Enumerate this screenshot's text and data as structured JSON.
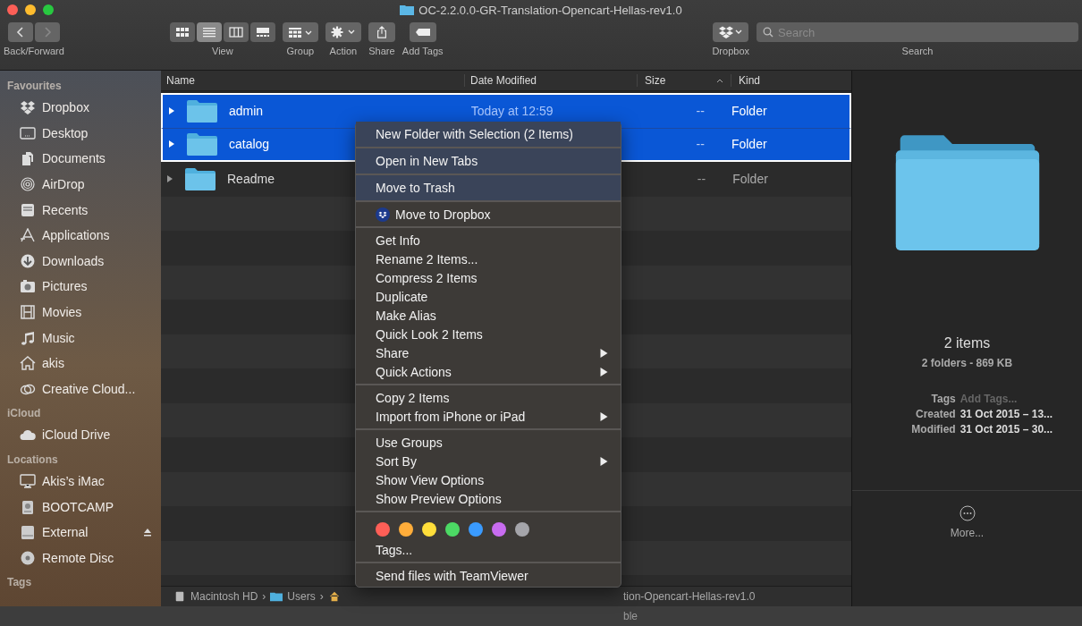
{
  "window": {
    "title": "OC-2.2.0.0-GR-Translation-Opencart-Hellas-rev1.0"
  },
  "toolbar": {
    "back_forward_label": "Back/Forward",
    "view": {
      "label": "View",
      "modes": [
        {
          "selected": false
        },
        {
          "selected": true
        },
        {
          "selected": false
        },
        {
          "selected": false
        }
      ]
    },
    "tools": [
      {
        "kind": "group",
        "label": "Group"
      },
      {
        "kind": "action",
        "label": "Action"
      },
      {
        "kind": "share",
        "label": "Share"
      },
      {
        "kind": "tags",
        "label": "Add Tags"
      }
    ],
    "dropbox_label": "Dropbox",
    "search": {
      "placeholder": "Search",
      "label": "Search"
    }
  },
  "sidebar": {
    "sections": [
      {
        "title": "Favourites",
        "items": [
          {
            "label": "Dropbox"
          },
          {
            "label": "Desktop"
          },
          {
            "label": "Documents"
          },
          {
            "label": "AirDrop"
          },
          {
            "label": "Recents"
          },
          {
            "label": "Applications"
          },
          {
            "label": "Downloads"
          },
          {
            "label": "Pictures"
          },
          {
            "label": "Movies"
          },
          {
            "label": "Music"
          },
          {
            "label": "akis"
          },
          {
            "label": "Creative Cloud..."
          }
        ]
      },
      {
        "title": "iCloud",
        "items": [
          {
            "label": "iCloud Drive"
          }
        ]
      },
      {
        "title": "Locations",
        "items": [
          {
            "label": "Akis’s iMac"
          },
          {
            "label": "BOOTCAMP"
          },
          {
            "label": "External",
            "eject": true
          },
          {
            "label": "Remote Disc"
          }
        ]
      },
      {
        "title": "Tags"
      }
    ]
  },
  "table": {
    "columns": [
      "Name",
      "Date Modified",
      "Size",
      "Kind"
    ],
    "rows": [
      {
        "name": "admin",
        "date": "Today at 12:59",
        "size": "--",
        "kind": "Folder",
        "selected": true
      },
      {
        "name": "catalog",
        "size": "--",
        "kind": "Folder",
        "selected": true
      },
      {
        "name": "Readme",
        "size": "--",
        "kind": "Folder",
        "selected": false
      }
    ]
  },
  "path_bar": {
    "items": [
      {
        "label": "Macintosh HD",
        "separator": "›"
      },
      {
        "label": "Users",
        "separator": "›"
      }
    ],
    "tail": "tion-Opencart-Hellas-rev1.0"
  },
  "status_bar": {
    "text": "ble"
  },
  "preview": {
    "count": "2 items",
    "summary": "2 folders - 869 KB",
    "details": [
      {
        "label": "Tags",
        "placeholder": "Add Tags..."
      },
      {
        "label": "Created",
        "value": "31 Oct 2015 – 13..."
      },
      {
        "label": "Modified",
        "value": "31 Oct 2015 – 30..."
      }
    ],
    "more": "More..."
  },
  "context_menu": {
    "groups": [
      [
        {
          "kind": "item",
          "label": "New Folder with Selection (2 Items)",
          "submenu": false
        }
      ],
      [
        {
          "kind": "item",
          "label": "Open in New Tabs",
          "submenu": false
        }
      ],
      [
        {
          "kind": "item",
          "label": "Move to Trash",
          "submenu": false
        }
      ],
      [
        {
          "kind": "dropbox",
          "label": "Move to Dropbox",
          "submenu": false
        }
      ],
      [
        {
          "kind": "item",
          "label": "Get Info",
          "submenu": false
        },
        {
          "kind": "item",
          "label": "Rename 2 Items...",
          "submenu": false
        },
        {
          "kind": "item",
          "label": "Compress 2 Items",
          "submenu": false
        },
        {
          "kind": "item",
          "label": "Duplicate",
          "submenu": false
        },
        {
          "kind": "item",
          "label": "Make Alias",
          "submenu": false
        },
        {
          "kind": "item",
          "label": "Quick Look 2 Items",
          "submenu": false
        },
        {
          "kind": "item",
          "label": "Share",
          "submenu": true
        },
        {
          "kind": "item",
          "label": "Quick Actions",
          "submenu": true
        }
      ],
      [
        {
          "kind": "item",
          "label": "Copy 2 Items",
          "submenu": false
        },
        {
          "kind": "item",
          "label": "Import from iPhone or iPad",
          "submenu": true
        }
      ],
      [
        {
          "kind": "item",
          "label": "Use Groups",
          "submenu": false
        },
        {
          "kind": "item",
          "label": "Sort By",
          "submenu": true
        },
        {
          "kind": "item",
          "label": "Show View Options",
          "submenu": false
        },
        {
          "kind": "item",
          "label": "Show Preview Options",
          "submenu": false
        }
      ],
      [
        {
          "kind": "colors",
          "tags": [
            {
              "color": "#ff5f57"
            },
            {
              "color": "#ffad3a"
            },
            {
              "color": "#ffde3a"
            },
            {
              "color": "#4cd964"
            },
            {
              "color": "#3a9bff"
            },
            {
              "color": "#c86cf0"
            },
            {
              "color": "#a5a5aa"
            }
          ]
        },
        {
          "kind": "item",
          "label": "Tags...",
          "submenu": false
        }
      ],
      [
        {
          "kind": "item",
          "label": "Send files with TeamViewer",
          "submenu": false
        }
      ]
    ]
  }
}
